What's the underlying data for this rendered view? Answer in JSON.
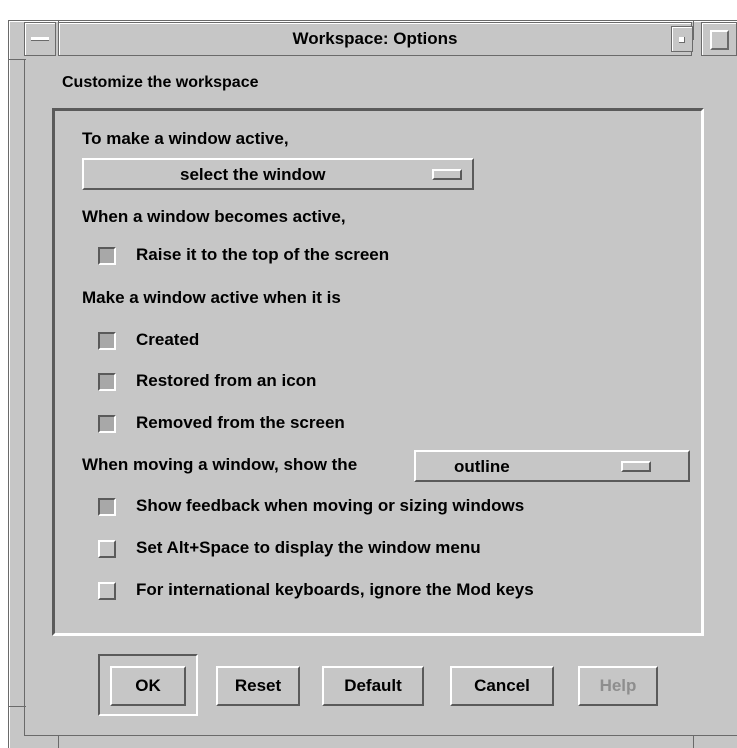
{
  "window": {
    "title": "Workspace: Options"
  },
  "dialog": {
    "subtitle": "Customize the workspace",
    "activate_label": "To make a window active,",
    "activate_select": "select the window",
    "when_active_label": "When a window becomes active,",
    "raise_label": "Raise it to the top of the screen",
    "raise_checked": true,
    "make_active_label": "Make a window active when it is",
    "created_label": "Created",
    "created_checked": true,
    "restored_label": "Restored from an icon",
    "restored_checked": true,
    "removed_label": "Removed from the screen",
    "removed_checked": true,
    "moving_label": "When moving a window, show the",
    "moving_select": "outline",
    "feedback_label": "Show feedback when moving or sizing windows",
    "feedback_checked": true,
    "altspace_label": "Set Alt+Space to display the window menu",
    "altspace_checked": false,
    "intl_label": "For international keyboards, ignore the Mod keys",
    "intl_checked": false
  },
  "buttons": {
    "ok": "OK",
    "reset": "Reset",
    "default": "Default",
    "cancel": "Cancel",
    "help": "Help"
  },
  "colors": {
    "face": "#c6c6c6",
    "shadow": "#5a5a5a",
    "highlight": "#ffffff",
    "checked": "#a8a8a8",
    "disabled_text": "#8e8e8e"
  },
  "icons": {
    "window_menu": "window-menu-icon",
    "minimize": "minimize-icon",
    "maximize": "maximize-icon"
  }
}
